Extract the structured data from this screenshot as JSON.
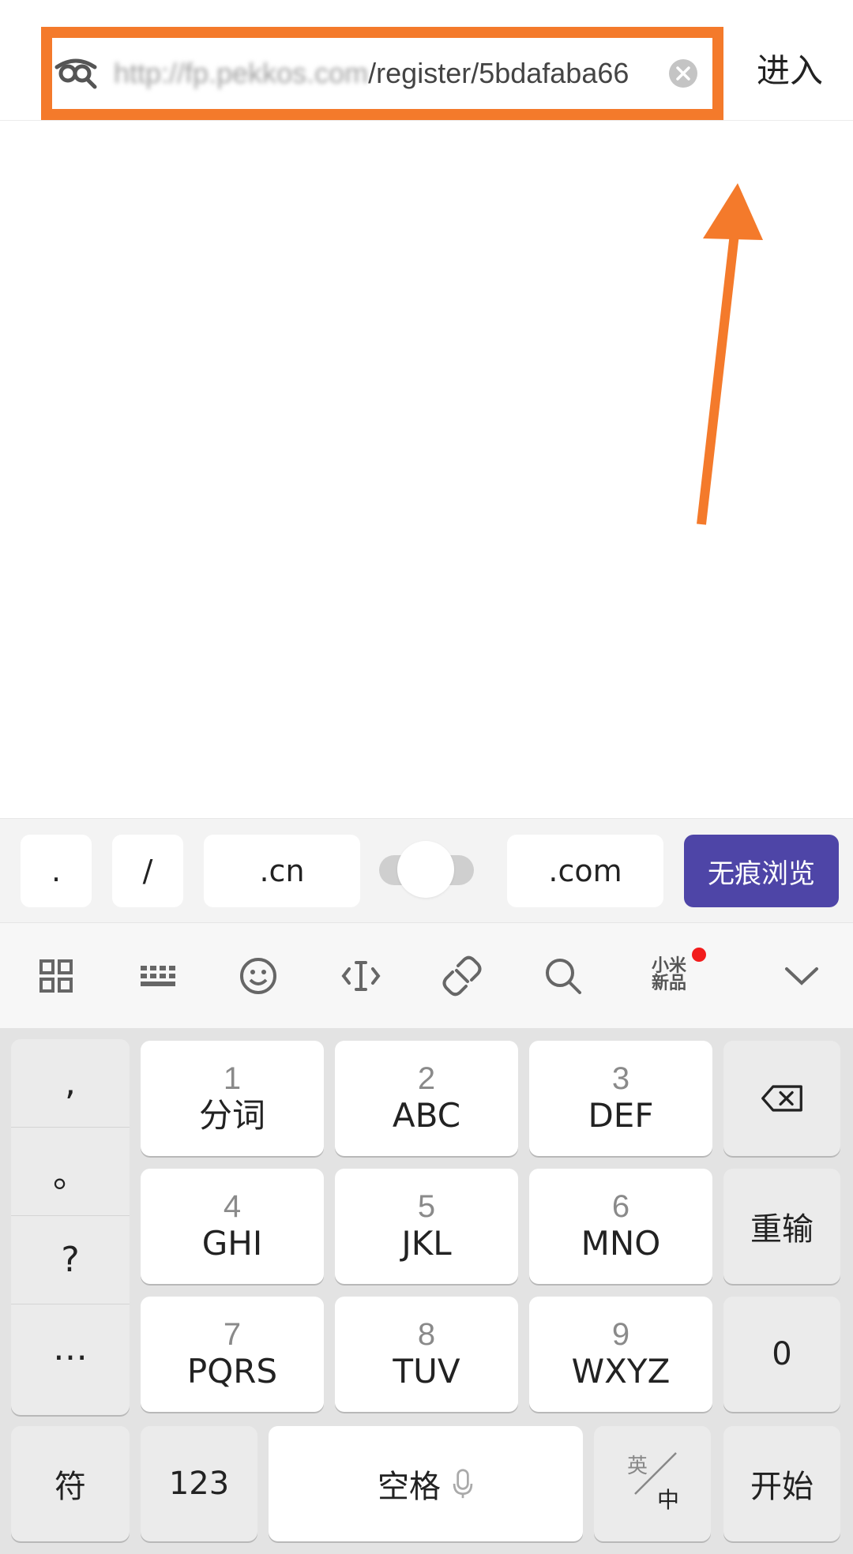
{
  "address_bar": {
    "url_blurred": "http://fp.pekkos.com",
    "url_visible": "/register/5bdafaba66",
    "enter_label": "进入"
  },
  "suggestions": {
    "dot": ".",
    "slash": "/",
    "cn": ".cn",
    "com": ".com",
    "incognito_label": "无痕浏览"
  },
  "toolbar": {
    "mi_new_label_line1": "小米",
    "mi_new_label_line2": "新品"
  },
  "keyboard": {
    "punct": [
      ",",
      "。",
      "?",
      "…"
    ],
    "keys": [
      {
        "num": "1",
        "letters": "分词"
      },
      {
        "num": "2",
        "letters": "ABC"
      },
      {
        "num": "3",
        "letters": "DEF"
      },
      {
        "num": "4",
        "letters": "GHI"
      },
      {
        "num": "5",
        "letters": "JKL"
      },
      {
        "num": "6",
        "letters": "MNO"
      },
      {
        "num": "7",
        "letters": "PQRS"
      },
      {
        "num": "8",
        "letters": "TUV"
      },
      {
        "num": "9",
        "letters": "WXYZ"
      }
    ],
    "retype_label": "重输",
    "zero_label": "0",
    "symbol_label": "符",
    "num_label": "123",
    "space_label": "空格",
    "lang_en": "英",
    "lang_zh": "中",
    "go_label": "开始"
  },
  "colors": {
    "highlight": "#f47a2b",
    "primary_button": "#4e45a7",
    "badge_dot": "#f21c1c"
  }
}
